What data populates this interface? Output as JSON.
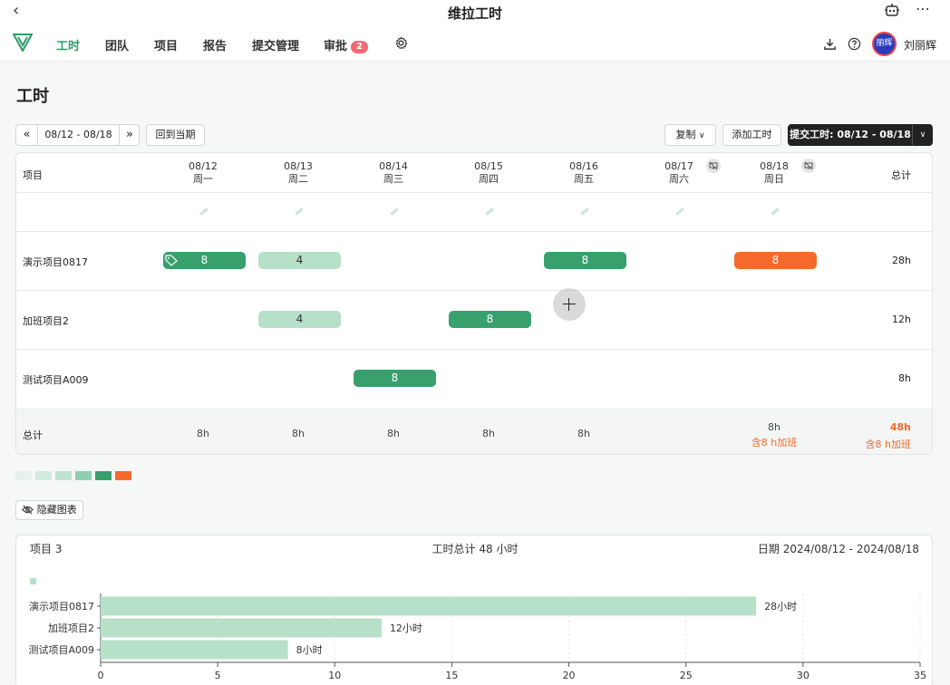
{
  "app": {
    "window_title": "维拉工时"
  },
  "nav": {
    "items": [
      {
        "label": "工时",
        "active": true
      },
      {
        "label": "团队"
      },
      {
        "label": "项目"
      },
      {
        "label": "报告"
      },
      {
        "label": "提交管理"
      },
      {
        "label": "审批",
        "badge": "2"
      }
    ],
    "user_name": "刘丽辉",
    "avatar_text": "丽辉"
  },
  "page": {
    "title": "工时",
    "date_range": "08/12 - 08/18",
    "back_to_current": "回到当期",
    "copy_label": "复制",
    "add_hours_label": "添加工时",
    "submit_label": "提交工时: 08/12 - 08/18",
    "hide_chart_label": "隐藏图表"
  },
  "table": {
    "project_header": "项目",
    "total_header": "总计",
    "days": [
      {
        "date": "08/12",
        "weekday": "周一"
      },
      {
        "date": "08/13",
        "weekday": "周二"
      },
      {
        "date": "08/14",
        "weekday": "周三"
      },
      {
        "date": "08/15",
        "weekday": "周四"
      },
      {
        "date": "08/16",
        "weekday": "周五"
      },
      {
        "date": "08/17",
        "weekday": "周六",
        "non_working": true
      },
      {
        "date": "08/18",
        "weekday": "周日",
        "non_working": true
      }
    ],
    "rows": [
      {
        "project": "演示项目0817",
        "total": "28h",
        "entries": [
          {
            "day": 0,
            "value": "8",
            "style": "dark",
            "tag": true
          },
          {
            "day": 1,
            "value": "4",
            "style": "light"
          },
          {
            "day": 4,
            "value": "8",
            "style": "dark"
          },
          {
            "day": 6,
            "value": "8",
            "style": "orange"
          }
        ]
      },
      {
        "project": "加班项目2",
        "total": "12h",
        "entries": [
          {
            "day": 1,
            "value": "4",
            "style": "light"
          },
          {
            "day": 3,
            "value": "8",
            "style": "dark"
          }
        ]
      },
      {
        "project": "测试项目A009",
        "total": "8h",
        "entries": [
          {
            "day": 2,
            "value": "8",
            "style": "dark"
          }
        ]
      }
    ],
    "totals_label": "总计",
    "day_totals": [
      "8h",
      "8h",
      "8h",
      "8h",
      "8h",
      "",
      "8h"
    ],
    "day_overtime": [
      "",
      "",
      "",
      "",
      "",
      "",
      "含8 h加班"
    ],
    "grand_total": "48h",
    "grand_overtime": "含8 h加班"
  },
  "legend_colors": [
    "#e6f2ed",
    "#d3ebdf",
    "#bfe2d0",
    "#8fd0ad",
    "#38a06d",
    "#f56a2c"
  ],
  "summary": {
    "project_count": "项目 3",
    "total_hours": "工时总计 48 小时",
    "date_range": "日期 2024/08/12 - 2024/08/18"
  },
  "chart_data": {
    "type": "bar",
    "orientation": "horizontal",
    "categories": [
      "演示项目0817",
      "加班项目2",
      "测试项目A009"
    ],
    "values": [
      28,
      12,
      8
    ],
    "data_labels": [
      "28小时",
      "12小时",
      "8小时"
    ],
    "x_ticks": [
      0,
      5,
      10,
      15,
      20,
      25,
      30,
      35
    ],
    "xlim": [
      0,
      35
    ],
    "bar_color": "#b6e0c8"
  }
}
